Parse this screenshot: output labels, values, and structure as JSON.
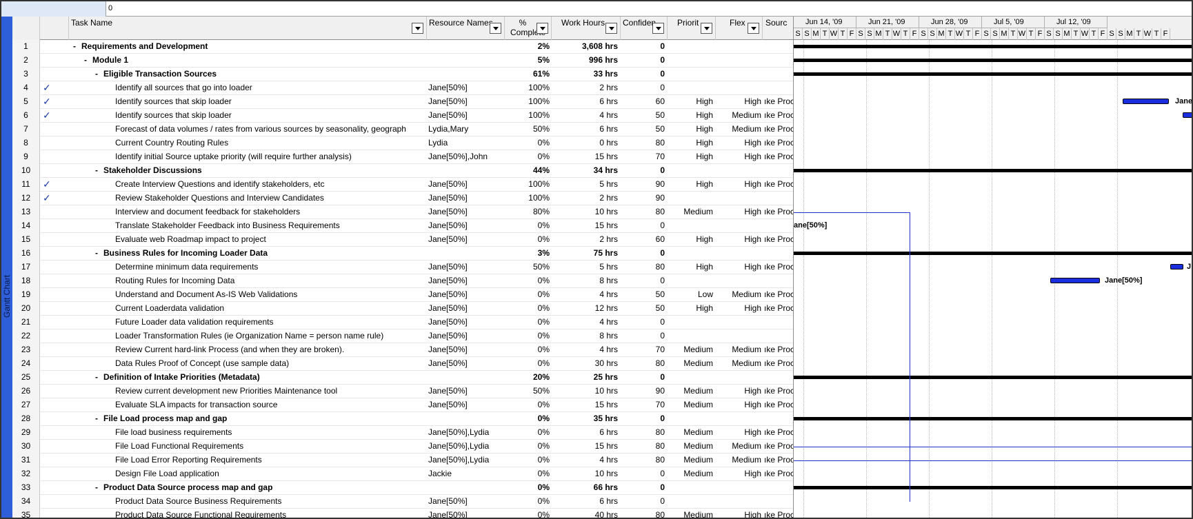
{
  "entry_bar": {
    "value": "0"
  },
  "view_bar": {
    "label": "Gantt Chart"
  },
  "columns": {
    "indicators_icon": "info-icon",
    "task_name": "Task Name",
    "resource_names": "Resource Names",
    "percent_complete_line1": "%",
    "percent_complete_line2": "Complete",
    "work_hours": "Work Hours",
    "confidence": "Confiden",
    "priority": "Priorit",
    "flex": "Flex",
    "source": "Sourc"
  },
  "rows": [
    {
      "id": "1",
      "check": "",
      "outline": "-",
      "name": "Requirements and Development",
      "bold": true,
      "level": 0,
      "res": "",
      "pct": "2%",
      "work": "3,608 hrs",
      "conf": "0",
      "prio": "",
      "flex": "",
      "src": ""
    },
    {
      "id": "2",
      "check": "",
      "outline": "-",
      "name": "Module 1",
      "bold": true,
      "level": 1,
      "res": "",
      "pct": "5%",
      "work": "996 hrs",
      "conf": "0",
      "prio": "",
      "flex": "",
      "src": ""
    },
    {
      "id": "3",
      "check": "",
      "outline": "-",
      "name": "Eligible Transaction Sources",
      "bold": true,
      "level": 2,
      "res": "",
      "pct": "61%",
      "work": "33 hrs",
      "conf": "0",
      "prio": "",
      "flex": "",
      "src": ""
    },
    {
      "id": "4",
      "check": "✓",
      "outline": "",
      "name": "Identify all sources that go into loader",
      "bold": false,
      "level": 3,
      "res": "Jane[50%]",
      "pct": "100%",
      "work": "2 hrs",
      "conf": "0",
      "prio": "",
      "flex": "",
      "src": ""
    },
    {
      "id": "5",
      "check": "✓",
      "outline": "",
      "name": "Identify sources that skip loader",
      "bold": false,
      "level": 3,
      "res": "Jane[50%]",
      "pct": "100%",
      "work": "6 hrs",
      "conf": "60",
      "prio": "High",
      "flex": "High",
      "src": "ıke Proce"
    },
    {
      "id": "6",
      "check": "✓",
      "outline": "",
      "name": "Identify sources that skip loader",
      "bold": false,
      "level": 3,
      "res": "Jane[50%]",
      "pct": "100%",
      "work": "4 hrs",
      "conf": "50",
      "prio": "High",
      "flex": "Medium",
      "src": "ıke Proce"
    },
    {
      "id": "7",
      "check": "",
      "outline": "",
      "name": "Forecast of data volumes / rates from various sources by seasonality, geograph",
      "bold": false,
      "level": 3,
      "res": "Lydia,Mary",
      "pct": "50%",
      "work": "6 hrs",
      "conf": "50",
      "prio": "High",
      "flex": "Medium",
      "src": "ıke Proce"
    },
    {
      "id": "8",
      "check": "",
      "outline": "",
      "name": "Current Country Routing Rules",
      "bold": false,
      "level": 3,
      "res": "Lydia",
      "pct": "0%",
      "work": "0 hrs",
      "conf": "80",
      "prio": "High",
      "flex": "High",
      "src": "ıke Proce"
    },
    {
      "id": "9",
      "check": "",
      "outline": "",
      "name": "Identify initial Source uptake priority (will require further analysis)",
      "bold": false,
      "level": 3,
      "res": "Jane[50%],John",
      "pct": "0%",
      "work": "15 hrs",
      "conf": "70",
      "prio": "High",
      "flex": "High",
      "src": "ıke Proce"
    },
    {
      "id": "10",
      "check": "",
      "outline": "-",
      "name": "Stakeholder Discussions",
      "bold": true,
      "level": 2,
      "res": "",
      "pct": "44%",
      "work": "34 hrs",
      "conf": "0",
      "prio": "",
      "flex": "",
      "src": ""
    },
    {
      "id": "11",
      "check": "✓",
      "outline": "",
      "name": "Create Interview Questions and identify stakeholders, etc",
      "bold": false,
      "level": 3,
      "res": "Jane[50%]",
      "pct": "100%",
      "work": "5 hrs",
      "conf": "90",
      "prio": "High",
      "flex": "High",
      "src": "ıke Proce"
    },
    {
      "id": "12",
      "check": "✓",
      "outline": "",
      "name": "Review Stakeholder Questions and Interview Candidates",
      "bold": false,
      "level": 3,
      "res": "Jane[50%]",
      "pct": "100%",
      "work": "2 hrs",
      "conf": "90",
      "prio": "",
      "flex": "",
      "src": ""
    },
    {
      "id": "13",
      "check": "",
      "outline": "",
      "name": "Interview and document feedback for stakeholders",
      "bold": false,
      "level": 3,
      "res": "Jane[50%]",
      "pct": "80%",
      "work": "10 hrs",
      "conf": "80",
      "prio": "Medium",
      "flex": "High",
      "src": "ıke Proce"
    },
    {
      "id": "14",
      "check": "",
      "outline": "",
      "name": "Translate Stakeholder Feedback into Business Requirements",
      "bold": false,
      "level": 3,
      "res": "Jane[50%]",
      "pct": "0%",
      "work": "15 hrs",
      "conf": "0",
      "prio": "",
      "flex": "",
      "src": ""
    },
    {
      "id": "15",
      "check": "",
      "outline": "",
      "name": "Evaluate web Roadmap impact to project",
      "bold": false,
      "level": 3,
      "res": "Jane[50%]",
      "pct": "0%",
      "work": "2 hrs",
      "conf": "60",
      "prio": "High",
      "flex": "High",
      "src": "ıke Proce"
    },
    {
      "id": "16",
      "check": "",
      "outline": "-",
      "name": "Business Rules for Incoming Loader Data",
      "bold": true,
      "level": 2,
      "res": "",
      "pct": "3%",
      "work": "75 hrs",
      "conf": "0",
      "prio": "",
      "flex": "",
      "src": ""
    },
    {
      "id": "17",
      "check": "",
      "outline": "",
      "name": "Determine minimum data requirements",
      "bold": false,
      "level": 3,
      "res": "Jane[50%]",
      "pct": "50%",
      "work": "5 hrs",
      "conf": "80",
      "prio": "High",
      "flex": "High",
      "src": "ıke Proce"
    },
    {
      "id": "18",
      "check": "",
      "outline": "",
      "name": "Routing Rules for Incoming Data",
      "bold": false,
      "level": 3,
      "res": "Jane[50%]",
      "pct": "0%",
      "work": "8 hrs",
      "conf": "0",
      "prio": "",
      "flex": "",
      "src": ""
    },
    {
      "id": "19",
      "check": "",
      "outline": "",
      "name": "Understand and Document As-IS Web Validations",
      "bold": false,
      "level": 3,
      "res": "Jane[50%]",
      "pct": "0%",
      "work": "4 hrs",
      "conf": "50",
      "prio": "Low",
      "flex": "Medium",
      "src": "ıke Proce"
    },
    {
      "id": "20",
      "check": "",
      "outline": "",
      "name": "Current Loaderdata validation",
      "bold": false,
      "level": 3,
      "res": "Jane[50%]",
      "pct": "0%",
      "work": "12 hrs",
      "conf": "50",
      "prio": "High",
      "flex": "High",
      "src": "ıke Proce"
    },
    {
      "id": "21",
      "check": "",
      "outline": "",
      "name": "Future Loader data validation requirements",
      "bold": false,
      "level": 3,
      "res": "Jane[50%]",
      "pct": "0%",
      "work": "4 hrs",
      "conf": "0",
      "prio": "",
      "flex": "",
      "src": ""
    },
    {
      "id": "22",
      "check": "",
      "outline": "",
      "name": "Loader Transformation Rules (ie Organization Name = person name rule)",
      "bold": false,
      "level": 3,
      "res": "Jane[50%]",
      "pct": "0%",
      "work": "8 hrs",
      "conf": "0",
      "prio": "",
      "flex": "",
      "src": ""
    },
    {
      "id": "23",
      "check": "",
      "outline": "",
      "name": "Review Current hard-link Process (and when they are broken).",
      "bold": false,
      "level": 3,
      "res": "Jane[50%]",
      "pct": "0%",
      "work": "4 hrs",
      "conf": "70",
      "prio": "Medium",
      "flex": "Medium",
      "src": "ıke Proce"
    },
    {
      "id": "24",
      "check": "",
      "outline": "",
      "name": "Data Rules Proof of Concept (use sample data)",
      "bold": false,
      "level": 3,
      "res": "Jane[50%]",
      "pct": "0%",
      "work": "30 hrs",
      "conf": "80",
      "prio": "Medium",
      "flex": "Medium",
      "src": "ıke Proce"
    },
    {
      "id": "25",
      "check": "",
      "outline": "-",
      "name": "Definition of Intake  Priorities (Metadata)",
      "bold": true,
      "level": 2,
      "res": "",
      "pct": "20%",
      "work": "25 hrs",
      "conf": "0",
      "prio": "",
      "flex": "",
      "src": ""
    },
    {
      "id": "26",
      "check": "",
      "outline": "",
      "name": "Review current development new Priorities Maintenance tool",
      "bold": false,
      "level": 3,
      "res": "Jane[50%]",
      "pct": "50%",
      "work": "10 hrs",
      "conf": "90",
      "prio": "Medium",
      "flex": "High",
      "src": "ıke Proce"
    },
    {
      "id": "27",
      "check": "",
      "outline": "",
      "name": "Evaluate SLA impacts for transaction source",
      "bold": false,
      "level": 3,
      "res": "Jane[50%]",
      "pct": "0%",
      "work": "15 hrs",
      "conf": "70",
      "prio": "Medium",
      "flex": "High",
      "src": "ıke Proce"
    },
    {
      "id": "28",
      "check": "",
      "outline": "-",
      "name": "File Load process map and gap",
      "bold": true,
      "level": 2,
      "res": "",
      "pct": "0%",
      "work": "35 hrs",
      "conf": "0",
      "prio": "",
      "flex": "",
      "src": ""
    },
    {
      "id": "29",
      "check": "",
      "outline": "",
      "name": "File load business requirements",
      "bold": false,
      "level": 3,
      "res": "Jane[50%],Lydia",
      "pct": "0%",
      "work": "6 hrs",
      "conf": "80",
      "prio": "Medium",
      "flex": "High",
      "src": "ıke Proce"
    },
    {
      "id": "30",
      "check": "",
      "outline": "",
      "name": "File Load Functional Requirements",
      "bold": false,
      "level": 3,
      "res": "Jane[50%],Lydia",
      "pct": "0%",
      "work": "15 hrs",
      "conf": "80",
      "prio": "Medium",
      "flex": "Medium",
      "src": "ıke Proce"
    },
    {
      "id": "31",
      "check": "",
      "outline": "",
      "name": "File Load Error Reporting Requirements",
      "bold": false,
      "level": 3,
      "res": "Jane[50%],Lydia",
      "pct": "0%",
      "work": "4 hrs",
      "conf": "80",
      "prio": "Medium",
      "flex": "Medium",
      "src": "ıke Proce"
    },
    {
      "id": "32",
      "check": "",
      "outline": "",
      "name": "Design File Load application",
      "bold": false,
      "level": 3,
      "res": "Jackie",
      "pct": "0%",
      "work": "10 hrs",
      "conf": "0",
      "prio": "Medium",
      "flex": "High",
      "src": "ıke Proce"
    },
    {
      "id": "33",
      "check": "",
      "outline": "-",
      "name": "Product Data Source process map and gap",
      "bold": true,
      "level": 2,
      "res": "",
      "pct": "0%",
      "work": "66 hrs",
      "conf": "0",
      "prio": "",
      "flex": "",
      "src": ""
    },
    {
      "id": "34",
      "check": "",
      "outline": "",
      "name": "Product Data Source Business Requirements",
      "bold": false,
      "level": 3,
      "res": "Jane[50%]",
      "pct": "0%",
      "work": "6 hrs",
      "conf": "0",
      "prio": "",
      "flex": "",
      "src": ""
    },
    {
      "id": "35",
      "check": "",
      "outline": "",
      "name": "Product Data Source Functional Requirements",
      "bold": false,
      "level": 3,
      "res": "Jane[50%]",
      "pct": "0%",
      "work": "40 hrs",
      "conf": "80",
      "prio": "Medium",
      "flex": "High",
      "src": "ıke Proce"
    }
  ],
  "gantt": {
    "weeks": [
      "Jun 14, '09",
      "Jun 21, '09",
      "Jun 28, '09",
      "Jul 5, '09",
      "Jul 12, '09"
    ],
    "days": [
      "S",
      "S",
      "M",
      "T",
      "W",
      "T",
      "F",
      "S",
      "S",
      "M",
      "T",
      "W",
      "T",
      "F",
      "S",
      "S",
      "M",
      "T",
      "W",
      "T",
      "F",
      "S",
      "S",
      "M",
      "T",
      "W",
      "T",
      "F",
      "S",
      "S",
      "M",
      "T",
      "W",
      "T",
      "F",
      "S",
      "S",
      "M",
      "T",
      "W",
      "T",
      "F"
    ],
    "bar_labels": {
      "row5": "Jane",
      "row14": "ane[50%]",
      "row17": "J",
      "row18": "Jane[50%]"
    },
    "bar_color": "#1a2ee0",
    "link_color": "#1f2fd0",
    "summary_color": "#000000"
  }
}
